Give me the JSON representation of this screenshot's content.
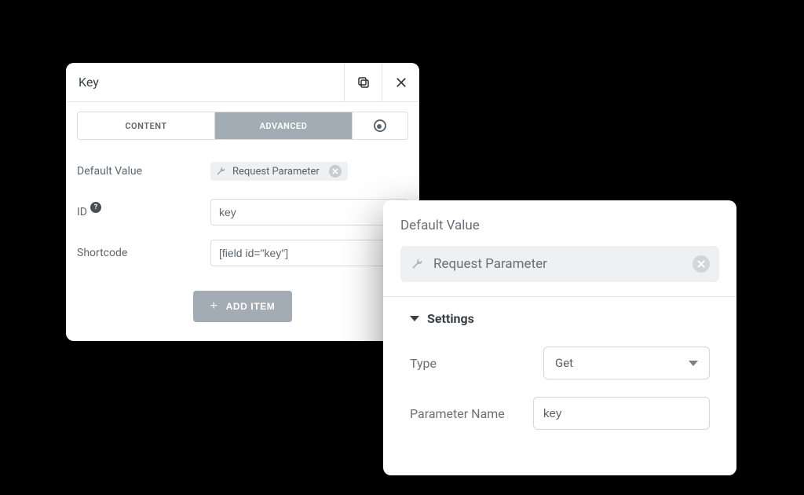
{
  "leftPanel": {
    "title": "Key",
    "tabs": {
      "content": "CONTENT",
      "advanced": "ADVANCED"
    },
    "rows": {
      "defaultValue": {
        "label": "Default Value",
        "chip": "Request Parameter"
      },
      "id": {
        "label": "ID",
        "value": "key"
      },
      "shortcode": {
        "label": "Shortcode",
        "value": "[field id=\"key\"]"
      }
    },
    "addButton": "ADD ITEM"
  },
  "popover": {
    "title": "Default Value",
    "chip": "Request Parameter",
    "settingsHeader": "Settings",
    "rows": {
      "type": {
        "label": "Type",
        "value": "Get"
      },
      "paramName": {
        "label": "Parameter Name",
        "value": "key"
      }
    }
  }
}
